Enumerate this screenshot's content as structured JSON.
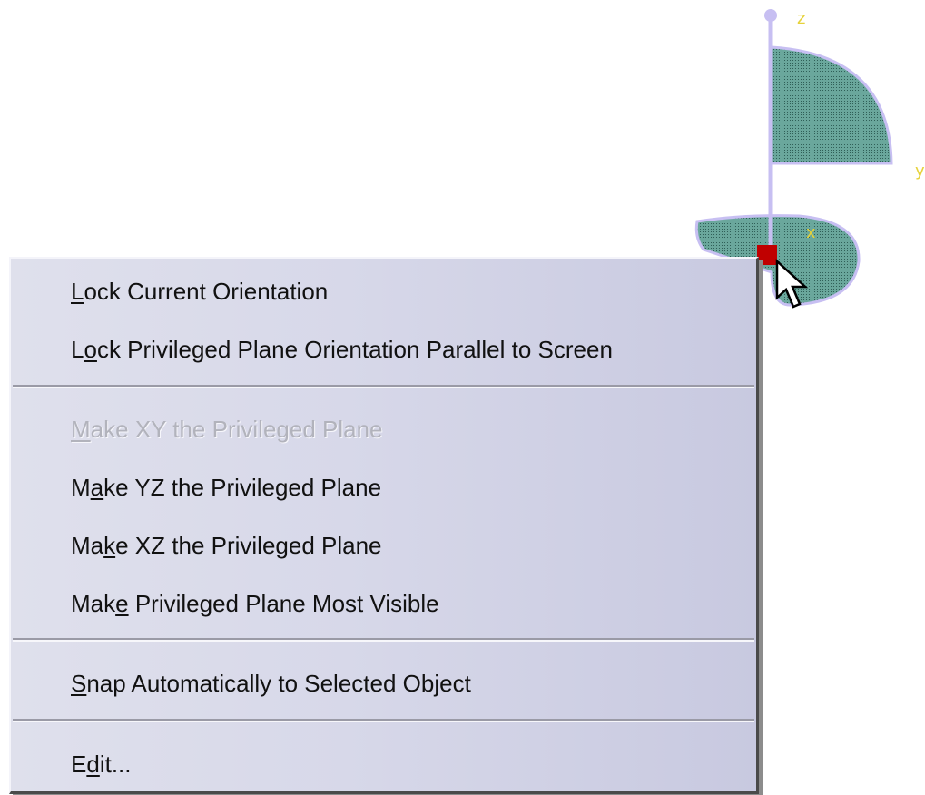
{
  "compass": {
    "axis_z": "z",
    "axis_y": "y",
    "axis_x": "x",
    "colors": {
      "axis": "#c7bff2",
      "plane_fill": "#5f9e93",
      "label": "#e6d23a",
      "handle": "#c00000"
    }
  },
  "context_menu": {
    "items": [
      {
        "pre": "",
        "mnemonic": "L",
        "post": "ock Current Orientation",
        "enabled": true
      },
      {
        "pre": "L",
        "mnemonic": "o",
        "post": "ck Privileged Plane Orientation Parallel to Screen",
        "enabled": true
      },
      {
        "pre": "",
        "mnemonic": "M",
        "post": "ake XY the Privileged Plane",
        "enabled": false
      },
      {
        "pre": "M",
        "mnemonic": "a",
        "post": "ke YZ the Privileged Plane",
        "enabled": true
      },
      {
        "pre": "Ma",
        "mnemonic": "k",
        "post": "e XZ the Privileged Plane",
        "enabled": true
      },
      {
        "pre": "Mak",
        "mnemonic": "e",
        "post": " Privileged Plane Most Visible",
        "enabled": true
      },
      {
        "pre": "",
        "mnemonic": "S",
        "post": "nap Automatically to Selected Object",
        "enabled": true
      },
      {
        "pre": "E",
        "mnemonic": "d",
        "post": "it...",
        "enabled": true
      }
    ]
  },
  "icons": {
    "cursor": "arrow-cursor-icon"
  }
}
